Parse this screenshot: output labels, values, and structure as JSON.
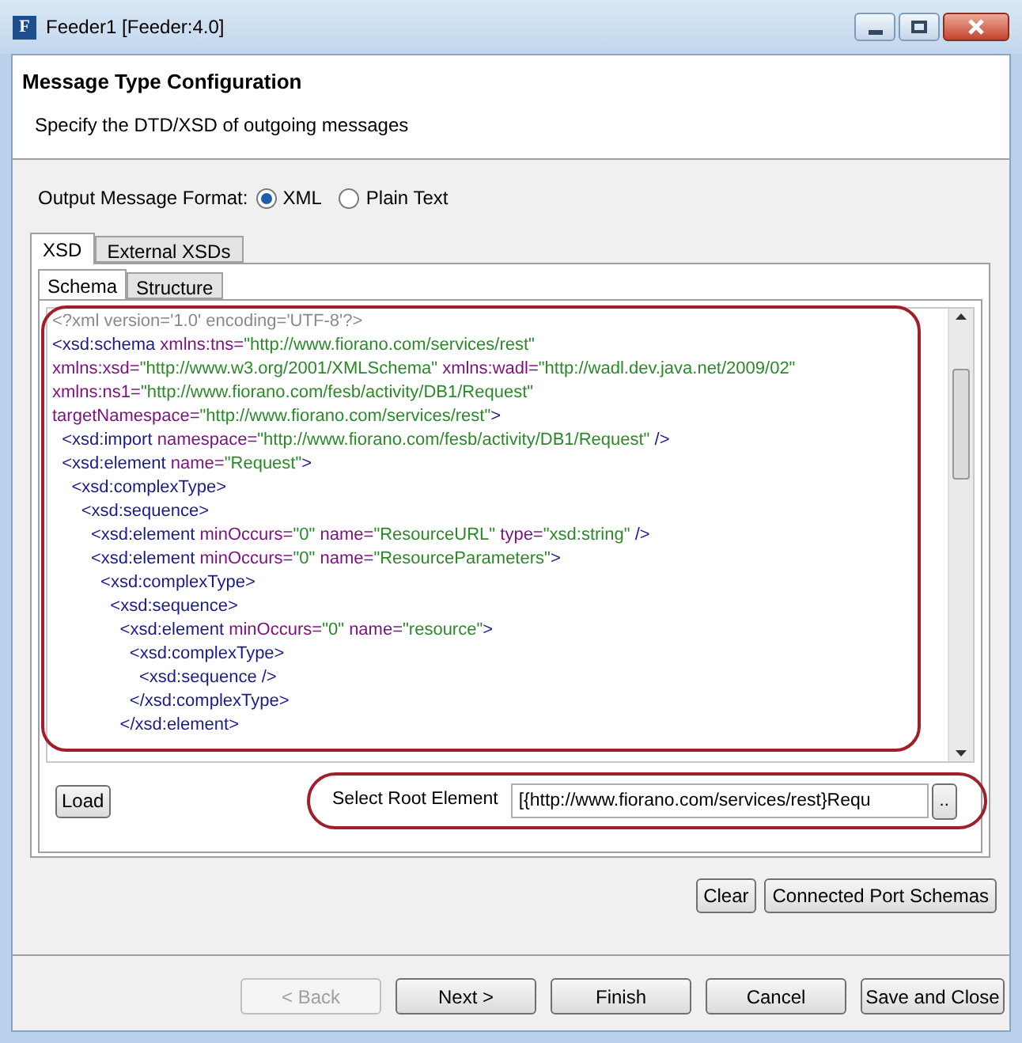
{
  "window": {
    "title": "Feeder1 [Feeder:4.0]",
    "logo": "F"
  },
  "header": {
    "title": "Message Type Configuration",
    "subtitle": "Specify the DTD/XSD of outgoing messages"
  },
  "format": {
    "label": "Output Message Format:",
    "options": [
      {
        "label": "XML",
        "selected": true
      },
      {
        "label": "Plain Text",
        "selected": false
      }
    ]
  },
  "tabs": [
    {
      "label": "XSD",
      "selected": true
    },
    {
      "label": "External XSDs",
      "selected": false
    }
  ],
  "subtabs": [
    {
      "label": "Schema",
      "selected": true
    },
    {
      "label": "Structure",
      "selected": false
    }
  ],
  "code_lines": [
    [
      {
        "kind": "pi",
        "text": "<?xml version='1.0' encoding='UTF-8'?>"
      }
    ],
    [
      {
        "kind": "tag",
        "text": "<xsd:schema "
      },
      {
        "kind": "attr",
        "text": "xmlns:tns="
      },
      {
        "kind": "value",
        "text": "\"http://www.fiorano.com/services/rest\""
      }
    ],
    [
      {
        "kind": "attr",
        "text": "xmlns:xsd="
      },
      {
        "kind": "value",
        "text": "\"http://www.w3.org/2001/XMLSchema\" "
      },
      {
        "kind": "attr",
        "text": "xmlns:wadl="
      },
      {
        "kind": "value",
        "text": "\"http://wadl.dev.java.net/2009/02\""
      }
    ],
    [
      {
        "kind": "attr",
        "text": "xmlns:ns1="
      },
      {
        "kind": "value",
        "text": "\"http://www.fiorano.com/fesb/activity/DB1/Request\""
      }
    ],
    [
      {
        "kind": "attr",
        "text": "targetNamespace="
      },
      {
        "kind": "value",
        "text": "\"http://www.fiorano.com/services/rest\""
      },
      {
        "kind": "tag",
        "text": ">"
      }
    ],
    [
      {
        "kind": "tag",
        "text": "  <xsd:import "
      },
      {
        "kind": "attr",
        "text": "namespace="
      },
      {
        "kind": "value",
        "text": "\"http://www.fiorano.com/fesb/activity/DB1/Request\" "
      },
      {
        "kind": "tag",
        "text": "/>"
      }
    ],
    [
      {
        "kind": "tag",
        "text": "  <xsd:element "
      },
      {
        "kind": "attr",
        "text": "name="
      },
      {
        "kind": "value",
        "text": "\"Request\""
      },
      {
        "kind": "tag",
        "text": ">"
      }
    ],
    [
      {
        "kind": "tag",
        "text": "    <xsd:complexType>"
      }
    ],
    [
      {
        "kind": "tag",
        "text": "      <xsd:sequence>"
      }
    ],
    [
      {
        "kind": "tag",
        "text": "        <xsd:element "
      },
      {
        "kind": "attr",
        "text": "minOccurs="
      },
      {
        "kind": "value",
        "text": "\"0\" "
      },
      {
        "kind": "attr",
        "text": "name="
      },
      {
        "kind": "value",
        "text": "\"ResourceURL\" "
      },
      {
        "kind": "attr",
        "text": "type="
      },
      {
        "kind": "value",
        "text": "\"xsd:string\" "
      },
      {
        "kind": "tag",
        "text": "/>"
      }
    ],
    [
      {
        "kind": "tag",
        "text": "        <xsd:element "
      },
      {
        "kind": "attr",
        "text": "minOccurs="
      },
      {
        "kind": "value",
        "text": "\"0\" "
      },
      {
        "kind": "attr",
        "text": "name="
      },
      {
        "kind": "value",
        "text": "\"ResourceParameters\""
      },
      {
        "kind": "tag",
        "text": ">"
      }
    ],
    [
      {
        "kind": "tag",
        "text": "          <xsd:complexType>"
      }
    ],
    [
      {
        "kind": "tag",
        "text": "            <xsd:sequence>"
      }
    ],
    [
      {
        "kind": "tag",
        "text": "              <xsd:element "
      },
      {
        "kind": "attr",
        "text": "minOccurs="
      },
      {
        "kind": "value",
        "text": "\"0\" "
      },
      {
        "kind": "attr",
        "text": "name="
      },
      {
        "kind": "value",
        "text": "\"resource\""
      },
      {
        "kind": "tag",
        "text": ">"
      }
    ],
    [
      {
        "kind": "tag",
        "text": "                <xsd:complexType>"
      }
    ],
    [
      {
        "kind": "tag",
        "text": "                  <xsd:sequence />"
      }
    ],
    [
      {
        "kind": "tag",
        "text": "                </xsd:complexType>"
      }
    ],
    [
      {
        "kind": "tag",
        "text": "              </xsd:element>"
      }
    ]
  ],
  "load_button": "Load",
  "root_element": {
    "label": "Select Root Element",
    "value": "[{http://www.fiorano.com/services/rest}Requ",
    "browse": ".."
  },
  "action_buttons": [
    {
      "label": "Clear"
    },
    {
      "label": "Connected Port Schemas"
    }
  ],
  "footer_buttons": [
    {
      "label": "< Back",
      "disabled": true
    },
    {
      "label": "Next >",
      "disabled": false
    },
    {
      "label": "Finish",
      "disabled": false
    },
    {
      "label": "Cancel",
      "disabled": false
    },
    {
      "label": "Save and Close",
      "disabled": false
    }
  ]
}
